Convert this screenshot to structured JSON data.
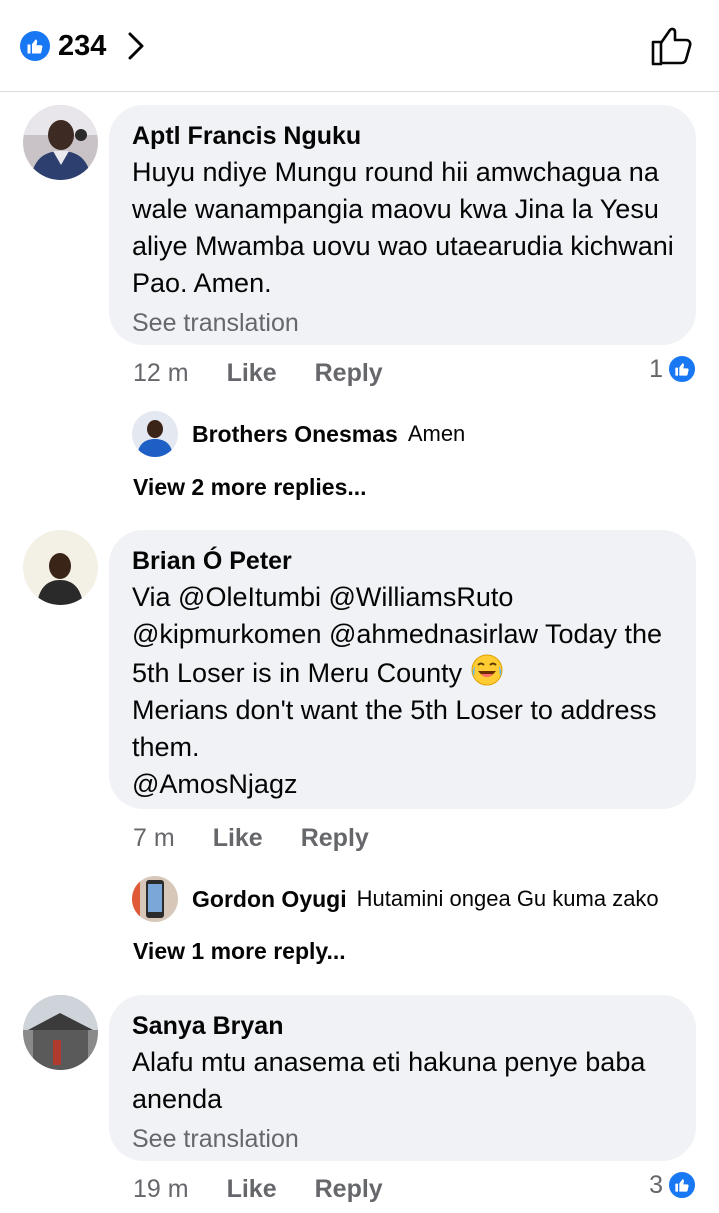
{
  "header": {
    "reaction_count": "234",
    "like_icon": "thumbs-up-icon",
    "chevron_icon": "chevron-right-icon"
  },
  "comments": [
    {
      "author": "Aptl Francis Nguku",
      "text": "Huyu ndiye Mungu round hii amwchagua na wale wanampangia maovu kwa Jina la Yesu aliye Mwamba uovu wao utaearudia kichwani Pao. Amen.",
      "see_translation": "See translation",
      "time": "12 m",
      "like_label": "Like",
      "reply_label": "Reply",
      "reactions": "1",
      "reply_preview": {
        "author": "Brothers Onesmas",
        "text": "Amen"
      },
      "view_more": "View 2 more replies..."
    },
    {
      "author": "Brian Ó Peter",
      "text_parts": [
        "Via @OleItumbi @WilliamsRuto @kipmurkomen @ahmednasirlaw Today the 5th Loser is in Meru County",
        "Merians don't want the 5th Loser to address them.",
        "@AmosNjagz"
      ],
      "emoji": "laughing-crying-emoji",
      "time": "7 m",
      "like_label": "Like",
      "reply_label": "Reply",
      "reply_preview": {
        "author": "Gordon Oyugi",
        "text": "Hutamini ongea Gu kuma zako"
      },
      "view_more": "View 1 more reply..."
    },
    {
      "author": "Sanya Bryan",
      "text": "Alafu mtu anasema eti hakuna penye baba anenda",
      "see_translation": "See translation",
      "time": "19 m",
      "like_label": "Like",
      "reply_label": "Reply",
      "reactions": "3"
    }
  ],
  "colors": {
    "facebook_blue": "#1877f2",
    "bubble_bg": "#f0f2f5",
    "secondary_text": "#65676b"
  }
}
